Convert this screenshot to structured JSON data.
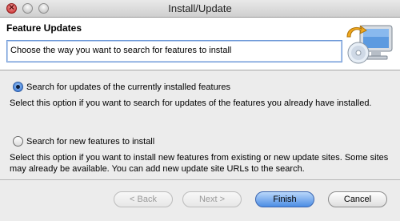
{
  "window": {
    "title": "Install/Update"
  },
  "header": {
    "title": "Feature Updates",
    "description": "Choose the way you want to search for features to install"
  },
  "options": [
    {
      "label": "Search for updates of the currently installed features",
      "description": "Select this option if you want to search for updates of the features you already have installed.",
      "checked": true
    },
    {
      "label": "Search for new features to install",
      "description": "Select this option if you want to install new features from existing or new update sites. Some sites may already be available. You can add new update site URLs to the search.",
      "checked": false
    }
  ],
  "buttons": {
    "back": "< Back",
    "next": "Next >",
    "finish": "Finish",
    "cancel": "Cancel"
  },
  "icons": {
    "wizard": "monitor-with-cd-icon",
    "close": "close-icon",
    "minimize": "minimize-icon",
    "maximize": "zoom-icon"
  }
}
